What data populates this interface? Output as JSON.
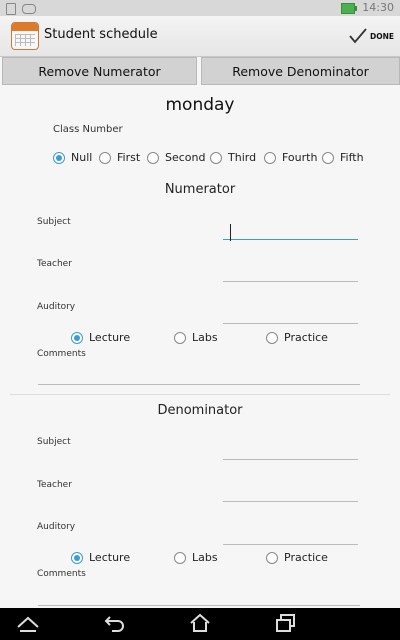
{
  "status_bar": {
    "time": "14:30"
  },
  "app": {
    "title": "Student schedule",
    "done_label": "DONE"
  },
  "buttons": {
    "remove_numerator": "Remove Numerator",
    "remove_denominator": "Remove Denominator"
  },
  "day": "monday",
  "class_number": {
    "label": "Class Number",
    "options": [
      "Null",
      "First",
      "Second",
      "Third",
      "Fourth",
      "Fifth"
    ],
    "selected": "Null"
  },
  "numerator": {
    "title": "Numerator",
    "subject_label": "Subject",
    "subject_value": "",
    "teacher_label": "Teacher",
    "teacher_value": "",
    "auditory_label": "Auditory",
    "auditory_value": "",
    "types": [
      "Lecture",
      "Labs",
      "Practice"
    ],
    "selected_type": "Lecture",
    "comments_label": "Comments",
    "comments_value": ""
  },
  "denominator": {
    "title": "Denominator",
    "subject_label": "Subject",
    "subject_value": "",
    "teacher_label": "Teacher",
    "teacher_value": "",
    "auditory_label": "Auditory",
    "auditory_value": "",
    "types": [
      "Lecture",
      "Labs",
      "Practice"
    ],
    "selected_type": "Lecture",
    "comments_label": "Comments",
    "comments_value": ""
  },
  "colors": {
    "accent": "#3a9bd9",
    "button_bg": "#d2d2d2",
    "navbar": "#000000"
  },
  "icons": {
    "app": "calendar-icon",
    "done": "checkmark-icon",
    "nav": [
      "back-icon",
      "home-icon",
      "recent-apps-icon",
      "menu-icon"
    ]
  }
}
